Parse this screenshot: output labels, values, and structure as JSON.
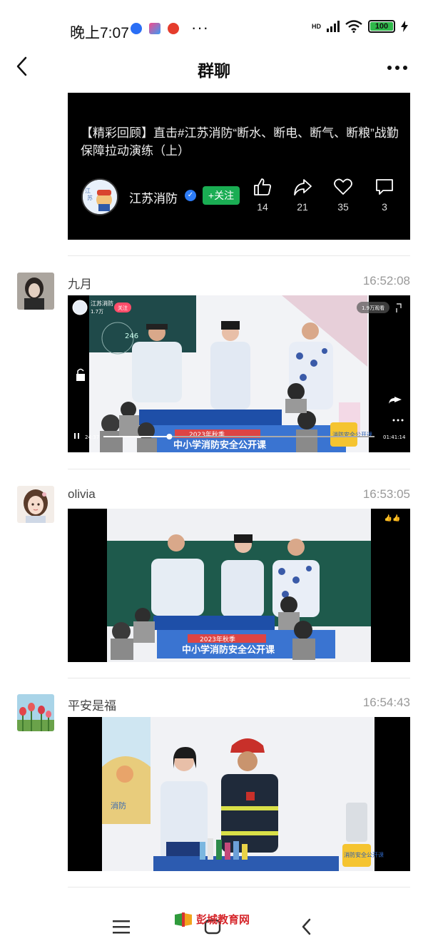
{
  "status_bar": {
    "time": "晚上7:07",
    "more": "···",
    "network": "HD",
    "battery": "100"
  },
  "nav": {
    "title": "群聊"
  },
  "shared_card": {
    "title": "【精彩回顾】直击#江苏消防“断水、断电、断气、断粮”战勤保障拉动演练（上）",
    "avatar_text": "江苏消防",
    "channel_name": "江苏消防",
    "follow_label": "+关注",
    "likes": "14",
    "shares": "21",
    "favorites": "35",
    "comments": "3"
  },
  "messages": [
    {
      "sender": "九月",
      "time": "16:52:08",
      "video": {
        "channel": "江苏消防",
        "followers": "1.7万",
        "follow": "关注",
        "views": "1.9万观看",
        "board_number": "246",
        "elapsed": "24:37",
        "duration": "01:41:14",
        "banner_top": "2023年秋季",
        "banner_main": "中小学消防安全公开课",
        "logo": "消防安全公开课"
      }
    },
    {
      "sender": "olivia",
      "time": "16:53:05",
      "video": {
        "banner_top": "2023年秋季",
        "banner_main": "中小学消防安全公开课",
        "emoji": "😘😘👍👍✌✌"
      }
    },
    {
      "sender": "平安是福",
      "time": "16:54:43",
      "video": {
        "poster_text": "消防",
        "logo": "消防安全公开课"
      }
    }
  ],
  "nav_bar": {
    "watermark": "彭城教育网"
  },
  "colors": {
    "follow_green": "#1aad53",
    "battery_green": "#2fb84a",
    "verified_blue": "#2d7cf6"
  }
}
